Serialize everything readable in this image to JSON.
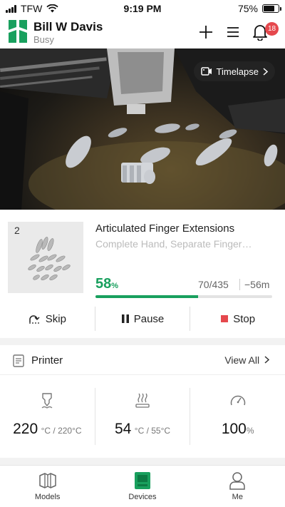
{
  "status_bar": {
    "carrier": "TFW",
    "time": "9:19 PM",
    "battery": "75%",
    "battery_level": 0.75
  },
  "header": {
    "user_name": "Bill W Davis",
    "user_status": "Busy",
    "notification_count": "18"
  },
  "camera": {
    "timelapse_label": "Timelapse"
  },
  "job": {
    "plate_number": "2",
    "title": "Articulated Finger Extensions",
    "subtitle": "Complete Hand, Separate Finger…",
    "progress_value": "58",
    "progress_unit": "%",
    "progress_fraction": 0.58,
    "layers": "70/435",
    "remaining": "−56m",
    "actions": {
      "skip": "Skip",
      "pause": "Pause",
      "stop": "Stop"
    }
  },
  "printer": {
    "title": "Printer",
    "view_all": "View All",
    "nozzle": {
      "value": "220",
      "unit": "°C / 220°C"
    },
    "bed": {
      "value": "54",
      "unit": "°C / 55°C"
    },
    "speed": {
      "value": "100",
      "unit": "%"
    }
  },
  "nav": {
    "models": "Models",
    "devices": "Devices",
    "me": "Me"
  },
  "colors": {
    "accent_green": "#19a05e",
    "stop_red": "#e5484d",
    "badge_red": "#e5484d"
  }
}
